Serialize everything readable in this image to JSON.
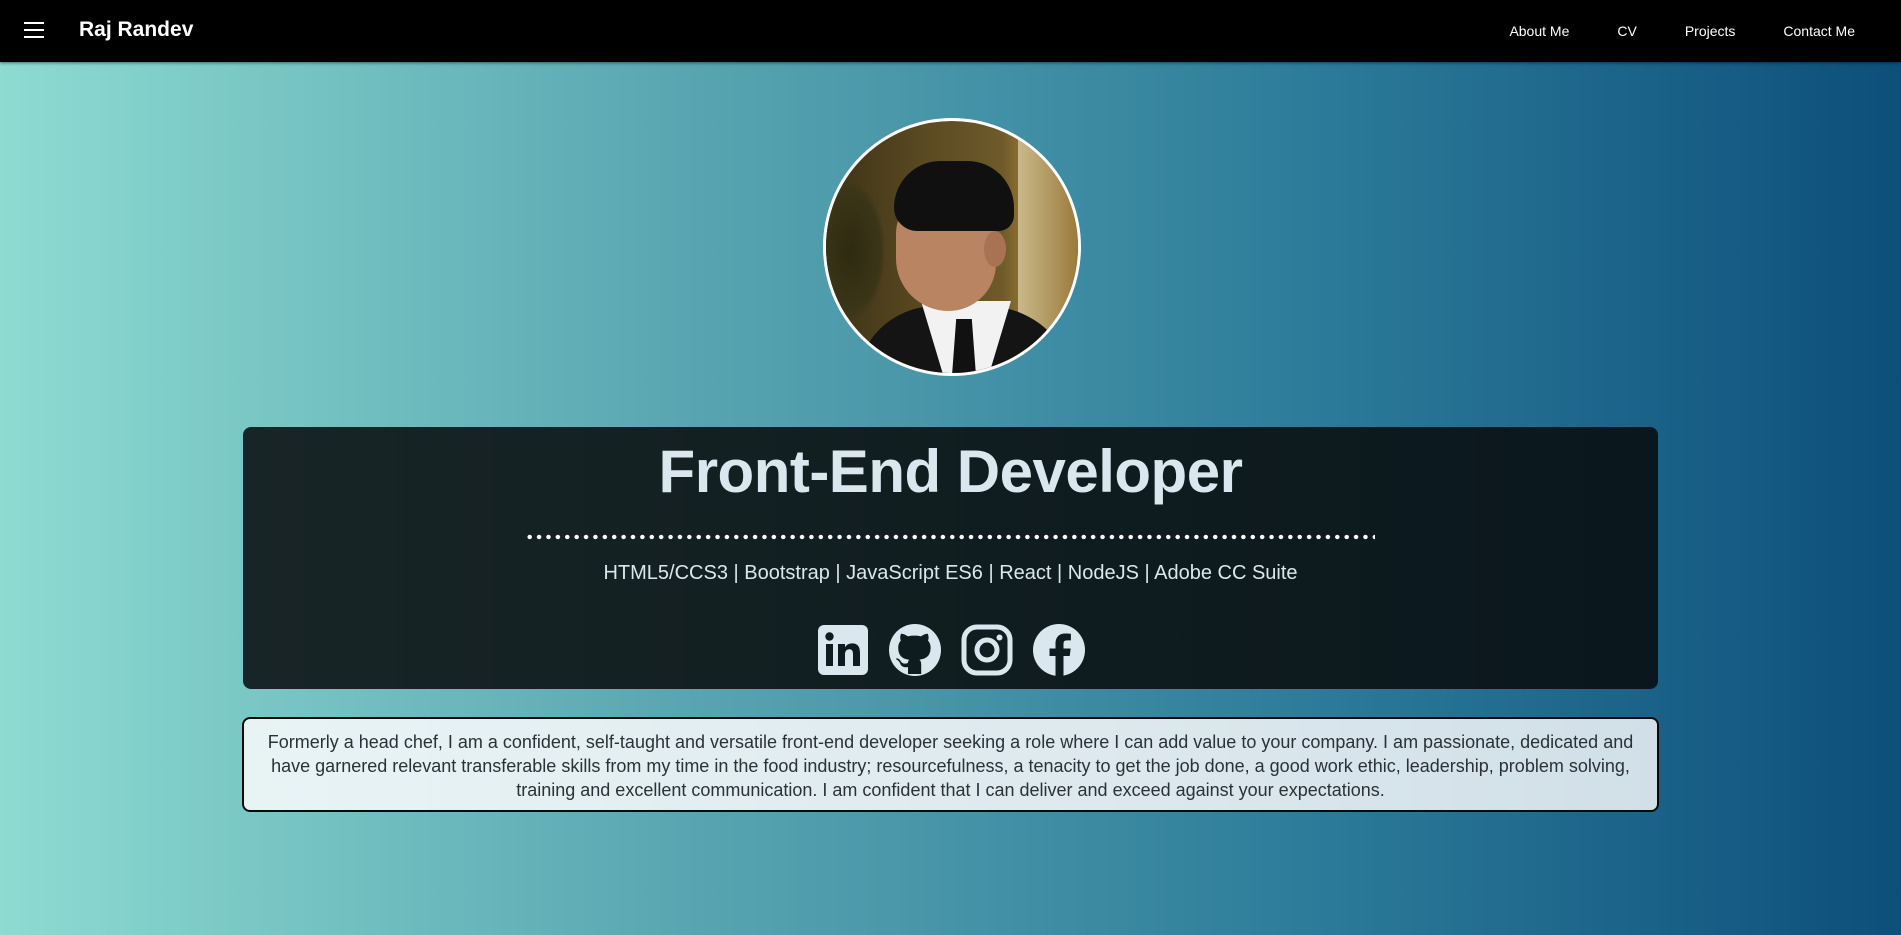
{
  "nav": {
    "brand": "Raj Randev",
    "menu_icon": "hamburger-menu-icon",
    "links": [
      "About Me",
      "CV",
      "Projects",
      "Contact Me"
    ]
  },
  "profile": {
    "image": "profile-photo",
    "title": "Front-End Developer",
    "skills": "HTML5/CCS3 | Bootstrap | JavaScript ES6 | React | NodeJS | Adobe CC Suite",
    "socials": [
      "linkedin-icon",
      "github-icon",
      "instagram-icon",
      "facebook-icon"
    ]
  },
  "bio": {
    "text": "Formerly a head chef, I am a confident, self-taught and versatile front-end developer seeking a role where I can add value to your company. I am passionate, dedicated and have garnered relevant transferable skills from my time in the food industry; resourcefulness, a tenacity to get the job done, a good work ethic, leadership, problem solving, training and excellent communication. I am confident that I can deliver and exceed against your expectations."
  },
  "colors": {
    "nav_bg": "#000000",
    "card_bg": "#0f1c1f",
    "gradient_start": "#8ddbd1",
    "gradient_end": "#0d4f7a",
    "text_light": "#dbe7ee"
  }
}
